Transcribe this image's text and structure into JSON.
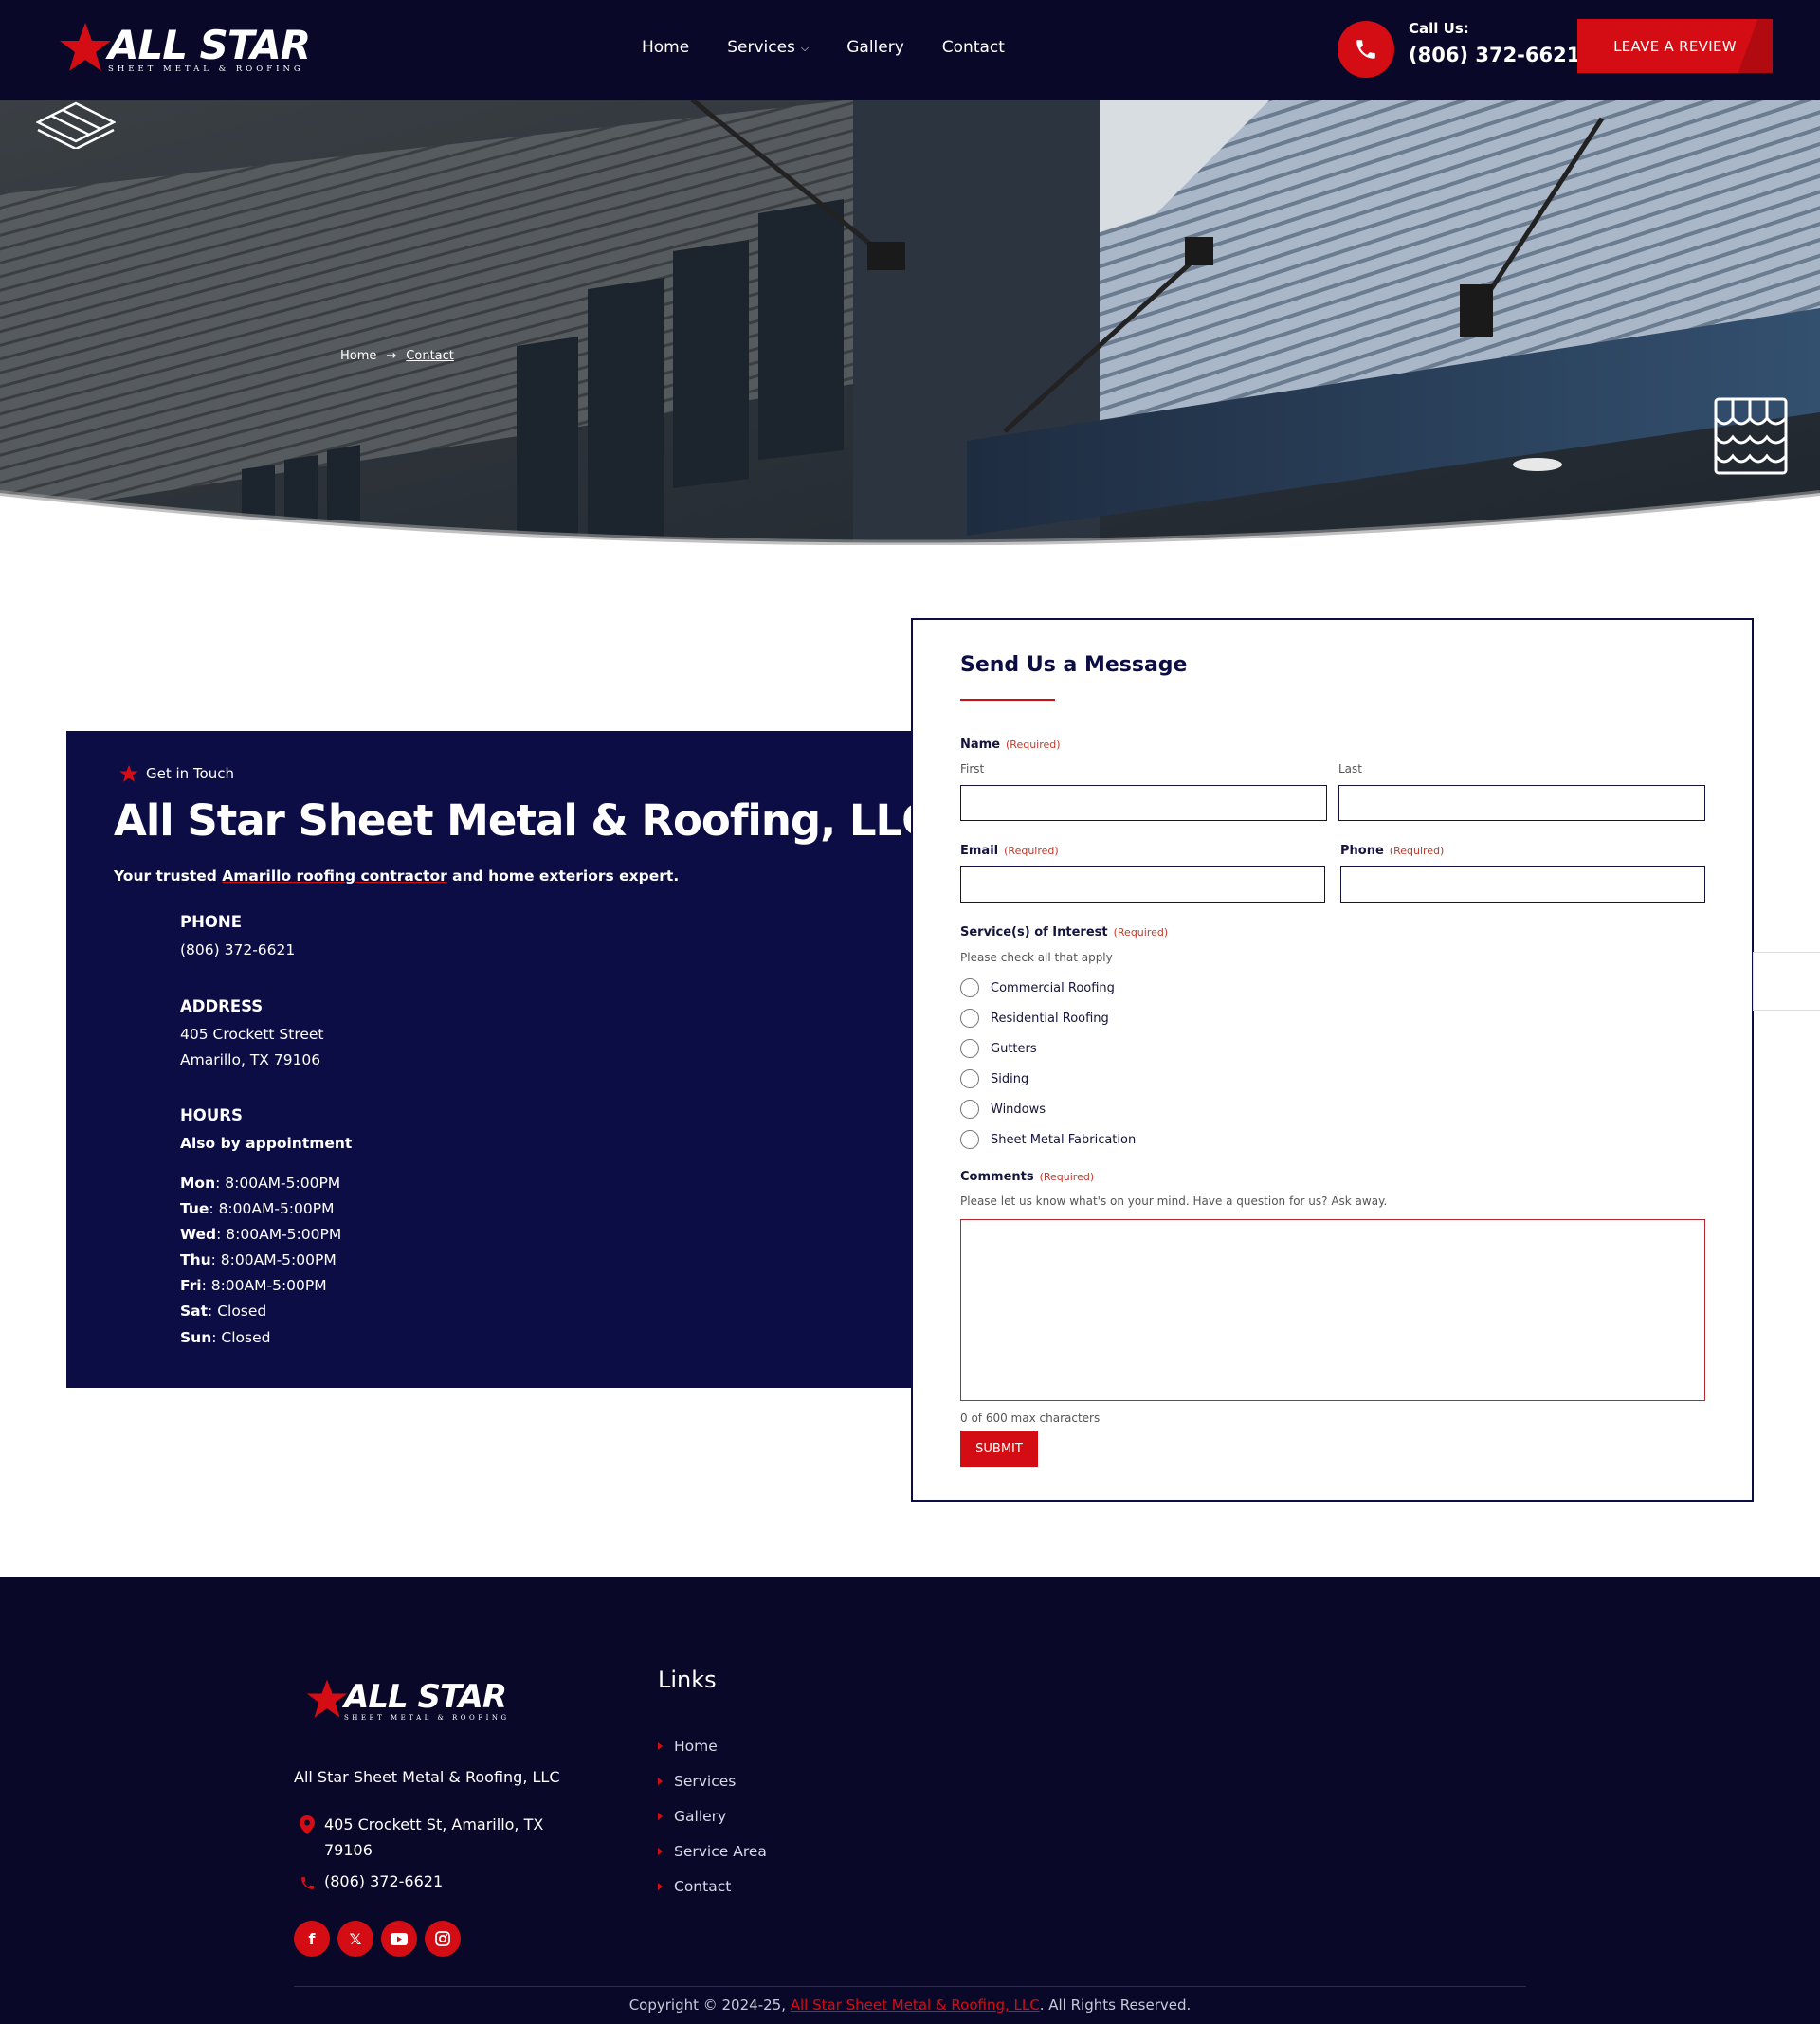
{
  "header": {
    "logo_text": "ALL STAR",
    "logo_subtext": "SHEET METAL & ROOFING",
    "nav": [
      {
        "label": "Home"
      },
      {
        "label": "Services"
      },
      {
        "label": "Gallery"
      },
      {
        "label": "Contact"
      }
    ],
    "call_label": "Call Us:",
    "call_number": "(806) 372-6621",
    "review_button": "LEAVE A REVIEW"
  },
  "hero": {
    "breadcrumb_home": "Home",
    "breadcrumb_arrow": "→",
    "breadcrumb_current": "Contact"
  },
  "info": {
    "tag": "Get in Touch",
    "title": "All Star Sheet Metal & Roofing, LLC",
    "lead_before": "Your trusted ",
    "lead_link": "Amarillo roofing contractor",
    "lead_after": " and home exteriors expert.",
    "phone_heading": "PHONE",
    "phone": "(806) 372-6621",
    "address_heading": "ADDRESS",
    "address_line1": "405 Crockett Street",
    "address_line2": "Amarillo, TX 79106",
    "hours_heading": "HOURS",
    "hours_note": "Also by appointment",
    "hours": [
      {
        "day": "Mon",
        "time": ": 8:00AM-5:00PM"
      },
      {
        "day": "Tue",
        "time": ": 8:00AM-5:00PM"
      },
      {
        "day": "Wed",
        "time": ": 8:00AM-5:00PM"
      },
      {
        "day": "Thu",
        "time": ": 8:00AM-5:00PM"
      },
      {
        "day": "Fri",
        "time": ": 8:00AM-5:00PM"
      },
      {
        "day": "Sat",
        "time": ": Closed"
      },
      {
        "day": "Sun",
        "time": ": Closed"
      }
    ]
  },
  "form": {
    "title": "Send Us a Message",
    "required_tag": "(Required)",
    "name_label": "Name",
    "first_label": "First",
    "last_label": "Last",
    "email_label": "Email",
    "phone_label": "Phone",
    "services_label": "Service(s) of Interest",
    "services_hint": "Please check all that apply",
    "services": [
      "Commercial Roofing",
      "Residential Roofing",
      "Gutters",
      "Siding",
      "Windows",
      "Sheet Metal Fabrication"
    ],
    "comments_label": "Comments",
    "comments_hint": "Please let us know what's on your mind. Have a question for us? Ask away.",
    "counter": "0 of 600 max characters",
    "submit": "SUBMIT"
  },
  "footer": {
    "logo_text": "ALL STAR",
    "logo_subtext": "SHEET METAL & ROOFING",
    "company": "All Star Sheet Metal & Roofing, LLC",
    "address": "405 Crockett St, Amarillo, TX 79106",
    "phone": "(806) 372-6621",
    "links_heading": "Links",
    "links": [
      "Home",
      "Services",
      "Gallery",
      "Service Area",
      "Contact"
    ],
    "socials": [
      "facebook-icon",
      "x-icon",
      "youtube-icon",
      "instagram-icon"
    ],
    "copyright_before": "Copyright © 2024-25, ",
    "copyright_company": "All Star Sheet Metal & Roofing, LLC",
    "copyright_after": ". All Rights Reserved."
  },
  "colors": {
    "navy": "#0a0828",
    "panel_navy": "#0d0d45",
    "accent_red": "#d40d14"
  }
}
